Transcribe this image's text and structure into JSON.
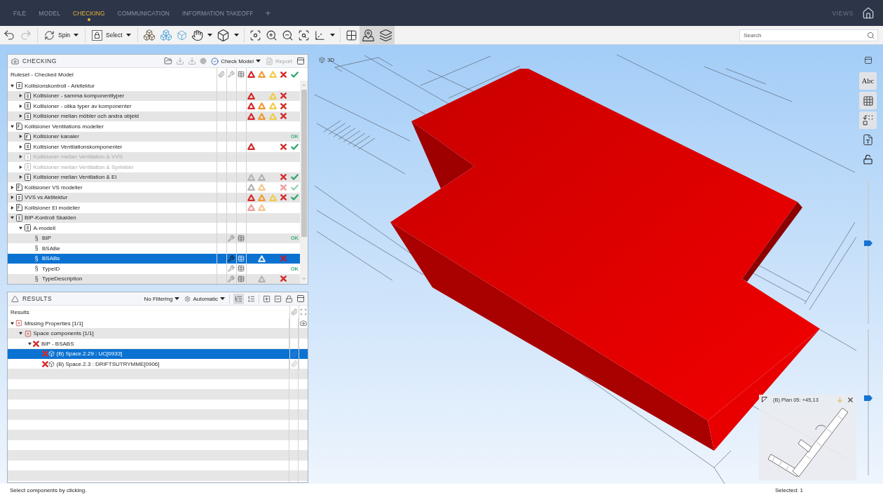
{
  "menu_bar": {
    "tabs": [
      {
        "label": "FILE",
        "selected": false
      },
      {
        "label": "MODEL",
        "selected": false
      },
      {
        "label": "CHECKING",
        "selected": true
      },
      {
        "label": "COMMUNICATION",
        "selected": false
      },
      {
        "label": "INFORMATION TAKEOFF",
        "selected": false
      }
    ],
    "add_tab": "+",
    "views_label": "VIEWS"
  },
  "toolbar": {
    "redo_disabled": true,
    "spin_label": "Spin",
    "select_label": "Select",
    "map_pressed": true,
    "layers_pressed": true,
    "search": {
      "placeholder": "Search"
    }
  },
  "checking_panel": {
    "title": "CHECKING",
    "check_model_label": "Check Model",
    "report_label": "Report",
    "report_disabled": true,
    "tree_header": "Ruleset - Checked Model",
    "rows": [
      {
        "label": "Kollisionskontroll - Arkitektur",
        "kind": "ruleset",
        "expanded": true,
        "selected": false,
        "children": [
          {
            "label": "Kollisioner - samma komponenttyper",
            "kind": "ruleset",
            "expanded": false,
            "selected": false,
            "issues": [
              {
                "kind": "critical",
                "color": "#d42a2a"
              },
              {
                "kind": "minor",
                "color": "#f1cc4a"
              },
              {
                "kind": "rejected",
                "color": "#d42a2a"
              }
            ]
          },
          {
            "label": "Kollisioner - olika typer av komponenter",
            "kind": "ruleset",
            "expanded": false,
            "selected": false,
            "issues": [
              {
                "kind": "critical",
                "color": "#d42a2a"
              },
              {
                "kind": "major",
                "color": "#ef9a35"
              },
              {
                "kind": "minor",
                "color": "#f1cc4a"
              },
              {
                "kind": "rejected",
                "color": "#d42a2a"
              }
            ]
          },
          {
            "label": "Kollisioner mellan möbler och andra objekt",
            "kind": "ruleset",
            "expanded": false,
            "selected": false,
            "issues": [
              {
                "kind": "critical",
                "color": "#d42a2a"
              },
              {
                "kind": "major",
                "color": "#ef9a35"
              },
              {
                "kind": "minor",
                "color": "#f1cc4a"
              },
              {
                "kind": "rejected",
                "color": "#d42a2a"
              }
            ]
          }
        ]
      },
      {
        "label": "Kollisioner Ventilations modeller",
        "kind": "group",
        "expanded": true,
        "selected": false,
        "children": [
          {
            "label": "Kollisioner kanaler",
            "kind": "group",
            "expanded": false,
            "selected": false,
            "disabled": false,
            "ok": "OK"
          },
          {
            "label": "Kollisioner Ventilationskomponenter",
            "kind": "ruleset",
            "expanded": false,
            "selected": false,
            "disabled": false,
            "issues": [
              {
                "kind": "critical",
                "color": "#d42a2a"
              },
              {
                "kind": "rejected",
                "color": "#d42a2a"
              },
              {
                "kind": "accepted",
                "color": "#2ea36b"
              }
            ]
          },
          {
            "label": "Kollisioner mellan Ventilation & VVS",
            "kind": "ruleset",
            "expanded": false,
            "selected": false,
            "disabled": true
          },
          {
            "label": "Kollisioner mellan Ventilation & Sprinkler",
            "kind": "ruleset",
            "expanded": false,
            "selected": false,
            "disabled": true
          },
          {
            "label": "Kollisioner mellan Ventilation & El",
            "kind": "ruleset",
            "expanded": false,
            "selected": false,
            "disabled": false,
            "issues": [
              {
                "kind": "critical",
                "color": "#b3b3b3"
              },
              {
                "kind": "major",
                "color": "#b3b3b3"
              },
              {
                "kind": "rejected",
                "color": "#d42a2a"
              },
              {
                "kind": "accepted",
                "color": "#2ea36b"
              }
            ]
          }
        ]
      },
      {
        "label": "Kollisioner VS modeller",
        "kind": "group",
        "expanded": false,
        "selected": false,
        "issues": [
          {
            "kind": "critical",
            "color": "#b3b3b3"
          },
          {
            "kind": "major",
            "color": "#f5c58f"
          },
          {
            "kind": "rejected",
            "color": "#ee9a9a"
          },
          {
            "kind": "accepted",
            "color": "#93d2b2"
          }
        ]
      },
      {
        "label": "VVS vs Aktitektur",
        "kind": "ruleset",
        "expanded": false,
        "selected": false,
        "issues": [
          {
            "kind": "critical",
            "color": "#d42a2a"
          },
          {
            "kind": "major",
            "color": "#ef9a35"
          },
          {
            "kind": "minor",
            "color": "#f1cc4a"
          },
          {
            "kind": "rejected",
            "color": "#d42a2a"
          },
          {
            "kind": "accepted",
            "color": "#2ea36b"
          }
        ]
      },
      {
        "label": "Kollisioner El modeller",
        "kind": "group",
        "expanded": false,
        "selected": false,
        "issues": [
          {
            "kind": "critical",
            "color": "#eb9c9c"
          },
          {
            "kind": "major",
            "color": "#f5c58f"
          }
        ]
      },
      {
        "label": "BIP-Kontroll Skalden",
        "kind": "ruleset",
        "expanded": true,
        "selected": false,
        "children": [
          {
            "label": "A-modell",
            "kind": "ruleset",
            "expanded": true,
            "selected": false,
            "children": [
              {
                "symbol": "§",
                "label": "BIP",
                "selected": false,
                "has_settings": true,
                "has_table": true,
                "ok": "OK"
              },
              {
                "symbol": "§",
                "label": "BSABe",
                "selected": false,
                "has_settings": false,
                "has_table": false
              },
              {
                "symbol": "§",
                "label": "BSABs",
                "selected": true,
                "has_settings": true,
                "has_table": true,
                "issues": [
                  {
                    "kind": "major",
                    "color": "#dce8f6"
                  },
                  {
                    "kind": "rejected",
                    "color": "#b8203e"
                  }
                ]
              },
              {
                "symbol": "§",
                "label": "TypeID",
                "selected": false,
                "has_settings": true,
                "has_table": true,
                "ok": "OK"
              },
              {
                "symbol": "§",
                "label": "TypeDescription",
                "selected": false,
                "has_settings": true,
                "has_table": true,
                "issues": [
                  {
                    "kind": "major",
                    "color": "#b3b3b3"
                  },
                  {
                    "kind": "rejected",
                    "color": "#d42a2a"
                  }
                ]
              }
            ]
          }
        ]
      }
    ]
  },
  "results_panel": {
    "title": "RESULTS",
    "filter_label": "No Filtering",
    "mode_label": "Automatic",
    "tree_view_pressed": true,
    "tree_header": "Results",
    "rows": [
      {
        "label": "Missing Properties [1/1]",
        "kind": "error-group",
        "expanded": true,
        "selected": false,
        "has_snapshot": true,
        "children": [
          {
            "label": "Space components [1/1]",
            "kind": "error-group",
            "expanded": true,
            "selected": false,
            "children": [
              {
                "label": "BIP - BSABS",
                "kind": "error",
                "expanded": true,
                "selected": false,
                "children": [
                  {
                    "label": "(B) Space.2.29 : UC[0933]",
                    "kind": "component",
                    "selected": true,
                    "linked": true
                  },
                  {
                    "label": "(B) Space.2.3 : DRIFTSUTRYMME[0906]",
                    "kind": "component",
                    "selected": false,
                    "linked": true
                  }
                ]
              }
            ]
          }
        ]
      }
    ]
  },
  "viewport": {
    "view_label": "3D",
    "tools": [
      {
        "kind": "text",
        "label": "Abc",
        "pressed": true
      },
      {
        "kind": "grid",
        "pressed": true
      },
      {
        "kind": "compare",
        "pressed": true
      },
      {
        "kind": "pdf",
        "pressed": false
      },
      {
        "kind": "lock",
        "pressed": false
      }
    ],
    "sliders": [
      {
        "level": 0.56
      },
      {
        "level": 0.53
      }
    ],
    "minimap": {
      "title": "(B) Plan 05: +45,13"
    }
  },
  "status_bar": {
    "message": "Select components by clicking.",
    "selection": "Selected: 1"
  }
}
